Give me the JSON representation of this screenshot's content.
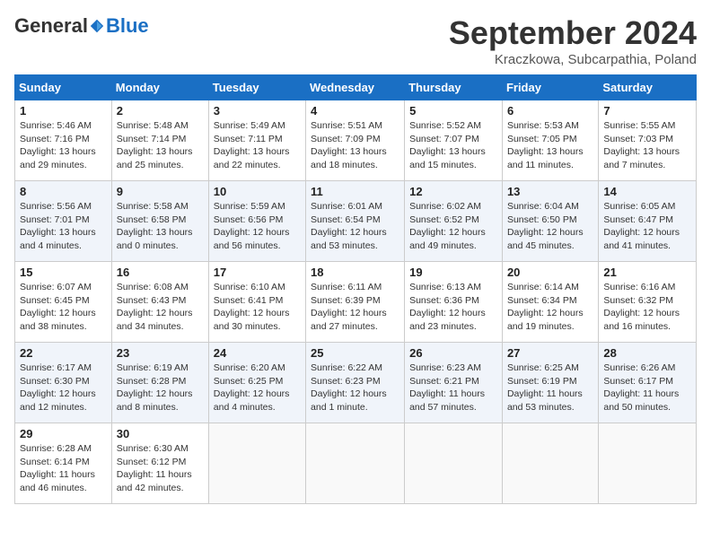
{
  "logo": {
    "general": "General",
    "blue": "Blue"
  },
  "header": {
    "month": "September 2024",
    "location": "Kraczkowa, Subcarpathia, Poland"
  },
  "weekdays": [
    "Sunday",
    "Monday",
    "Tuesday",
    "Wednesday",
    "Thursday",
    "Friday",
    "Saturday"
  ],
  "weeks": [
    [
      {
        "day": "1",
        "info": "Sunrise: 5:46 AM\nSunset: 7:16 PM\nDaylight: 13 hours\nand 29 minutes."
      },
      {
        "day": "2",
        "info": "Sunrise: 5:48 AM\nSunset: 7:14 PM\nDaylight: 13 hours\nand 25 minutes."
      },
      {
        "day": "3",
        "info": "Sunrise: 5:49 AM\nSunset: 7:11 PM\nDaylight: 13 hours\nand 22 minutes."
      },
      {
        "day": "4",
        "info": "Sunrise: 5:51 AM\nSunset: 7:09 PM\nDaylight: 13 hours\nand 18 minutes."
      },
      {
        "day": "5",
        "info": "Sunrise: 5:52 AM\nSunset: 7:07 PM\nDaylight: 13 hours\nand 15 minutes."
      },
      {
        "day": "6",
        "info": "Sunrise: 5:53 AM\nSunset: 7:05 PM\nDaylight: 13 hours\nand 11 minutes."
      },
      {
        "day": "7",
        "info": "Sunrise: 5:55 AM\nSunset: 7:03 PM\nDaylight: 13 hours\nand 7 minutes."
      }
    ],
    [
      {
        "day": "8",
        "info": "Sunrise: 5:56 AM\nSunset: 7:01 PM\nDaylight: 13 hours\nand 4 minutes."
      },
      {
        "day": "9",
        "info": "Sunrise: 5:58 AM\nSunset: 6:58 PM\nDaylight: 13 hours\nand 0 minutes."
      },
      {
        "day": "10",
        "info": "Sunrise: 5:59 AM\nSunset: 6:56 PM\nDaylight: 12 hours\nand 56 minutes."
      },
      {
        "day": "11",
        "info": "Sunrise: 6:01 AM\nSunset: 6:54 PM\nDaylight: 12 hours\nand 53 minutes."
      },
      {
        "day": "12",
        "info": "Sunrise: 6:02 AM\nSunset: 6:52 PM\nDaylight: 12 hours\nand 49 minutes."
      },
      {
        "day": "13",
        "info": "Sunrise: 6:04 AM\nSunset: 6:50 PM\nDaylight: 12 hours\nand 45 minutes."
      },
      {
        "day": "14",
        "info": "Sunrise: 6:05 AM\nSunset: 6:47 PM\nDaylight: 12 hours\nand 41 minutes."
      }
    ],
    [
      {
        "day": "15",
        "info": "Sunrise: 6:07 AM\nSunset: 6:45 PM\nDaylight: 12 hours\nand 38 minutes."
      },
      {
        "day": "16",
        "info": "Sunrise: 6:08 AM\nSunset: 6:43 PM\nDaylight: 12 hours\nand 34 minutes."
      },
      {
        "day": "17",
        "info": "Sunrise: 6:10 AM\nSunset: 6:41 PM\nDaylight: 12 hours\nand 30 minutes."
      },
      {
        "day": "18",
        "info": "Sunrise: 6:11 AM\nSunset: 6:39 PM\nDaylight: 12 hours\nand 27 minutes."
      },
      {
        "day": "19",
        "info": "Sunrise: 6:13 AM\nSunset: 6:36 PM\nDaylight: 12 hours\nand 23 minutes."
      },
      {
        "day": "20",
        "info": "Sunrise: 6:14 AM\nSunset: 6:34 PM\nDaylight: 12 hours\nand 19 minutes."
      },
      {
        "day": "21",
        "info": "Sunrise: 6:16 AM\nSunset: 6:32 PM\nDaylight: 12 hours\nand 16 minutes."
      }
    ],
    [
      {
        "day": "22",
        "info": "Sunrise: 6:17 AM\nSunset: 6:30 PM\nDaylight: 12 hours\nand 12 minutes."
      },
      {
        "day": "23",
        "info": "Sunrise: 6:19 AM\nSunset: 6:28 PM\nDaylight: 12 hours\nand 8 minutes."
      },
      {
        "day": "24",
        "info": "Sunrise: 6:20 AM\nSunset: 6:25 PM\nDaylight: 12 hours\nand 4 minutes."
      },
      {
        "day": "25",
        "info": "Sunrise: 6:22 AM\nSunset: 6:23 PM\nDaylight: 12 hours\nand 1 minute."
      },
      {
        "day": "26",
        "info": "Sunrise: 6:23 AM\nSunset: 6:21 PM\nDaylight: 11 hours\nand 57 minutes."
      },
      {
        "day": "27",
        "info": "Sunrise: 6:25 AM\nSunset: 6:19 PM\nDaylight: 11 hours\nand 53 minutes."
      },
      {
        "day": "28",
        "info": "Sunrise: 6:26 AM\nSunset: 6:17 PM\nDaylight: 11 hours\nand 50 minutes."
      }
    ],
    [
      {
        "day": "29",
        "info": "Sunrise: 6:28 AM\nSunset: 6:14 PM\nDaylight: 11 hours\nand 46 minutes."
      },
      {
        "day": "30",
        "info": "Sunrise: 6:30 AM\nSunset: 6:12 PM\nDaylight: 11 hours\nand 42 minutes."
      },
      {
        "day": "",
        "info": ""
      },
      {
        "day": "",
        "info": ""
      },
      {
        "day": "",
        "info": ""
      },
      {
        "day": "",
        "info": ""
      },
      {
        "day": "",
        "info": ""
      }
    ]
  ]
}
